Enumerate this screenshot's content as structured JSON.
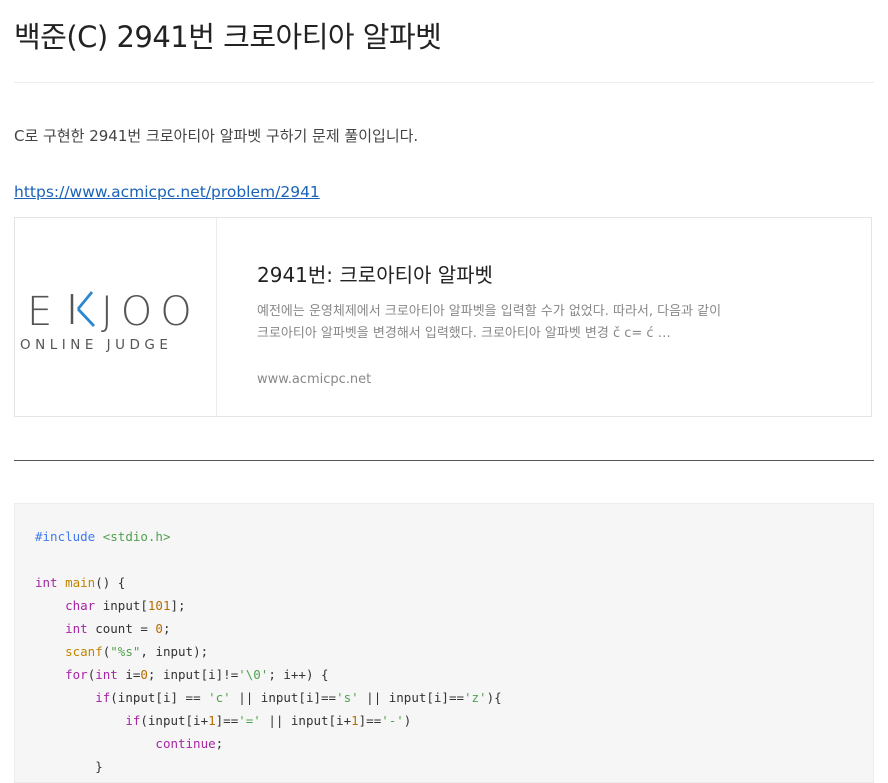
{
  "post": {
    "title": "백준(C) 2941번 크로아티아 알파벳",
    "intro": "C로 구현한 2941번 크로아티아 알파벳 구하기 문제 풀이입니다.",
    "link_text": "https://www.acmicpc.net/problem/2941"
  },
  "link_card": {
    "logo_main_left": "E",
    "logo_main_right": "JOO",
    "logo_sub": "ONLINE JUDGE",
    "title": "2941번: 크로아티아 알파벳",
    "description": "예전에는 운영체제에서 크로아티아 알파벳을 입력할 수가 없었다. 따라서, 다음과 같이 크로아티아 알파벳을 변경해서 입력했다. 크로아티아 알파벳 변경 č c= ć …",
    "host": "www.acmicpc.net"
  },
  "code": {
    "language": "c",
    "lines": [
      "#include <stdio.h>",
      "",
      "int main() {",
      "    char input[101];",
      "    int count = 0;",
      "    scanf(\"%s\", input);",
      "    for(int i=0; input[i]!='\\0'; i++) {",
      "        if(input[i] == 'c' || input[i]=='s' || input[i]=='z'){",
      "            if(input[i+1]=='=' || input[i+1]=='-')",
      "                continue;",
      "        }"
    ]
  },
  "colors": {
    "link": "#1a63b8",
    "logo_accent": "#2a87d0",
    "logo_dark": "#555555",
    "code_bg": "#f6f6f6"
  }
}
